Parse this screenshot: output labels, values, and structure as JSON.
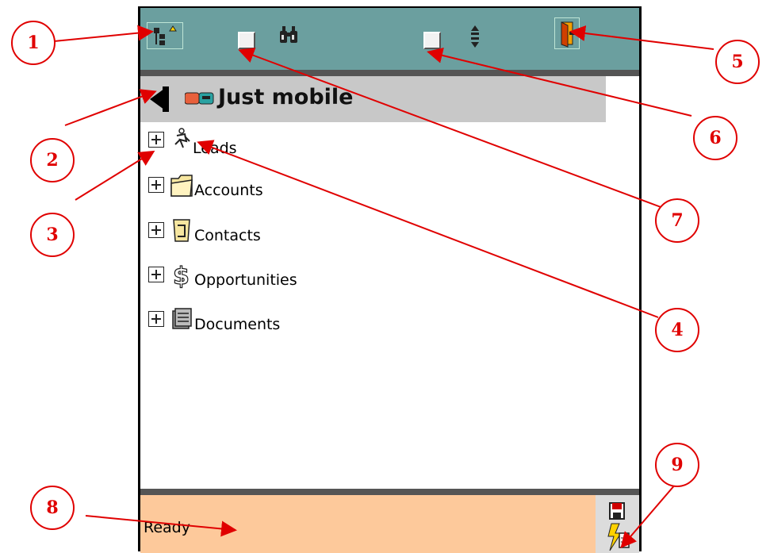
{
  "context": {
    "title": "Just mobile"
  },
  "tree": {
    "items": [
      {
        "label": "Leads",
        "icon": "leads-person-icon"
      },
      {
        "label": "Accounts",
        "icon": "folder-icon"
      },
      {
        "label": "Contacts",
        "icon": "contact-card-icon"
      },
      {
        "label": "Opportunities",
        "icon": "dollar-icon"
      },
      {
        "label": "Documents",
        "icon": "document-stack-icon"
      }
    ]
  },
  "status": {
    "text": "Ready"
  },
  "callouts": [
    "1",
    "2",
    "3",
    "4",
    "5",
    "6",
    "7",
    "8",
    "9"
  ],
  "colors": {
    "toolbar": "#6b9f9f",
    "context_bar": "#c8c8c8",
    "status_bar": "#fdc99b",
    "annotation": "#e00000"
  }
}
